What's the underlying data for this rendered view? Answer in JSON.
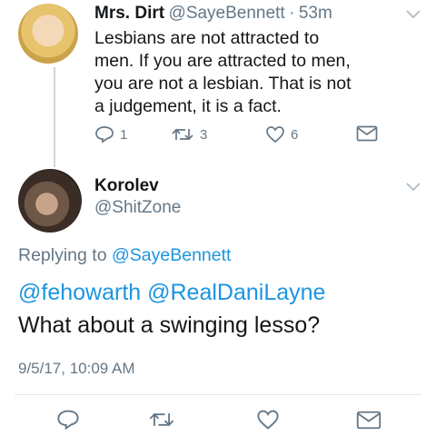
{
  "parent_tweet": {
    "author_name": "Mrs. Dirt",
    "handle": "@SayeBennett",
    "separator": "·",
    "time": "53m",
    "text_lines": [
      "Lesbians are not attracted to",
      "men. If you are attracted to men,",
      "you are not a lesbian. That is not",
      "a judgement, it is a fact."
    ],
    "reply_count": "1",
    "retweet_count": "3",
    "like_count": "6"
  },
  "reply_tweet": {
    "author_name": "Korolev",
    "handle": "@ShitZone",
    "replying_prefix": "Replying to",
    "replying_to": "@SayeBennett",
    "mentions": "@fehowarth @RealDaniLayne",
    "text": "What about a swinging lesso?",
    "timestamp": "9/5/17, 10:09 AM"
  },
  "colors": {
    "link": "#1b95e0",
    "muted": "#657786",
    "divider": "#e1e8ed"
  }
}
